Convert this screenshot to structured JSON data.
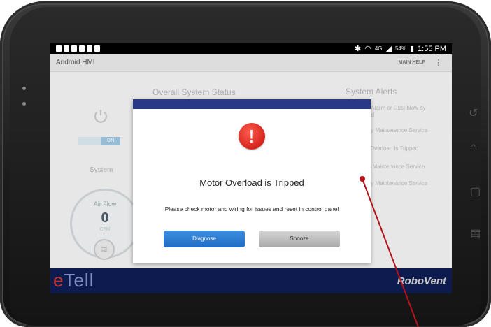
{
  "status_bar": {
    "battery": "54%",
    "time": "1:55 PM",
    "network": "4G"
  },
  "app_bar": {
    "title": "Android HMI",
    "help": "MAIN HELP",
    "overflow": "⋮"
  },
  "background": {
    "overall_status": "Overall System Status",
    "system_alerts": "System Alerts",
    "toggle_label": "ON",
    "system_label": "System",
    "airflow": {
      "label": "Air Flow",
      "value": "0",
      "unit": "CFM"
    },
    "alerts": [
      "e Alarm or Dust blow by",
      "ted",
      "hly Maintenance Service",
      "r Overload is Tripped",
      "al Maintenance Service",
      "hly Maintenance Service"
    ]
  },
  "dialog": {
    "icon": "!",
    "title": "Motor Overload is Tripped",
    "message": "Please check motor and wiring for issues and reset in control panel",
    "diagnose_label": "Diagnose",
    "snooze_label": "Snooze"
  },
  "footer": {
    "logo_e": "e",
    "logo_rest": "Tell",
    "brand": "RoboVent"
  },
  "colors": {
    "dialog_header": "#283a86",
    "alert_red": "#d4241c",
    "diagnose_blue": "#2b7dd4",
    "footer_navy": "#0d1b4e",
    "pointer_red": "#b5121b"
  }
}
